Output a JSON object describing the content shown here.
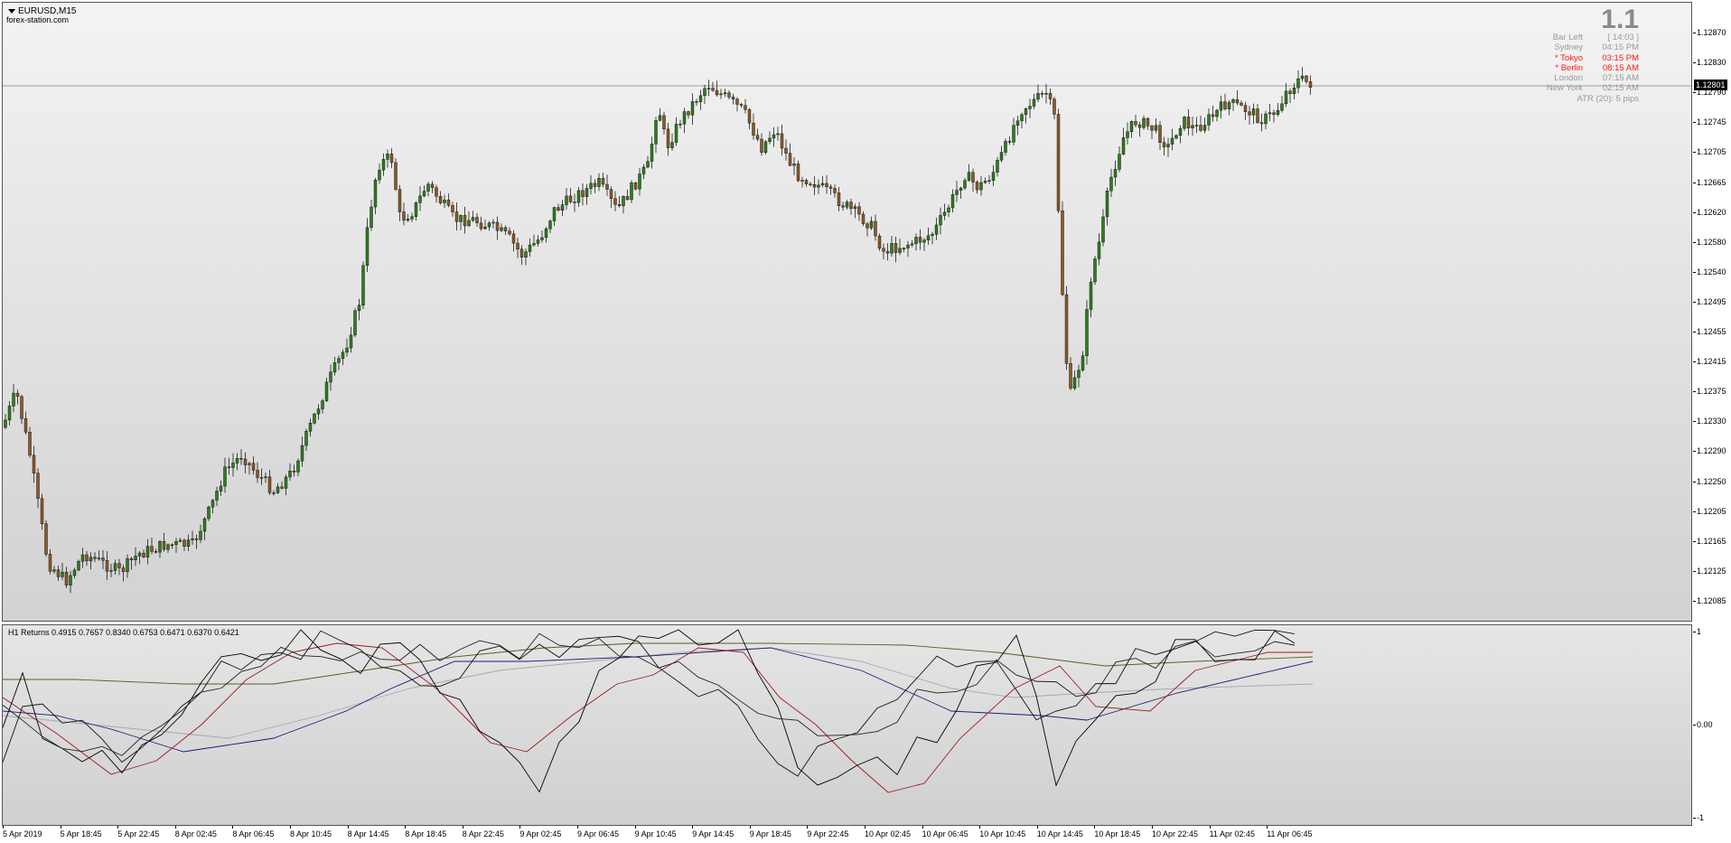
{
  "window": {
    "symbol": "EURUSD,M15",
    "brand": "forex-station.com"
  },
  "clock_panel": {
    "spread": "1.1",
    "rows": [
      {
        "label": "Bar Left",
        "value": "[ 14:03 ]",
        "highlight": false
      },
      {
        "label": "Sydney",
        "value": "04:15 PM",
        "highlight": false
      },
      {
        "label": "* Tokyo",
        "value": "03:15 PM",
        "highlight": true
      },
      {
        "label": "* Berlin",
        "value": "08:15 AM",
        "highlight": true
      },
      {
        "label": "London",
        "value": "07:15 AM",
        "highlight": false
      },
      {
        "label": "New York",
        "value": "02:15 AM",
        "highlight": false
      }
    ],
    "atr": "ATR (20): 5 pips"
  },
  "price_axis": {
    "labels": [
      "1.12870",
      "1.12830",
      "1.12790",
      "1.12745",
      "1.12705",
      "1.12665",
      "1.12620",
      "1.12580",
      "1.12540",
      "1.12495",
      "1.12455",
      "1.12415",
      "1.12375",
      "1.12330",
      "1.12290",
      "1.12250",
      "1.12205",
      "1.12165",
      "1.12125",
      "1.12085"
    ],
    "current_price": "1.12801"
  },
  "indicator": {
    "label": "H1 Returns 0.4915 0.7657 0.8340 0.6753 0.6471 0.6370 0.6421",
    "axis_labels": [
      "1",
      "0.00",
      "-1"
    ]
  },
  "time_axis": {
    "labels": [
      "5 Apr 2019",
      "5 Apr 18:45",
      "5 Apr 22:45",
      "8 Apr 02:45",
      "8 Apr 06:45",
      "8 Apr 10:45",
      "8 Apr 14:45",
      "8 Apr 18:45",
      "8 Apr 22:45",
      "9 Apr 02:45",
      "9 Apr 06:45",
      "9 Apr 10:45",
      "9 Apr 14:45",
      "9 Apr 18:45",
      "9 Apr 22:45",
      "10 Apr 02:45",
      "10 Apr 06:45",
      "10 Apr 10:45",
      "10 Apr 14:45",
      "10 Apr 18:45",
      "10 Apr 22:45",
      "11 Apr 02:45",
      "11 Apr 06:45"
    ]
  },
  "colors": {
    "bull": "#2f7d1e",
    "bear": "#8b5a2b",
    "wick": "#000000",
    "indicator_red": "#9b1b1b",
    "indicator_blue": "#1c1c7a",
    "indicator_olive": "#5d5a2c",
    "indicator_gray": "#a8a8a8"
  }
}
